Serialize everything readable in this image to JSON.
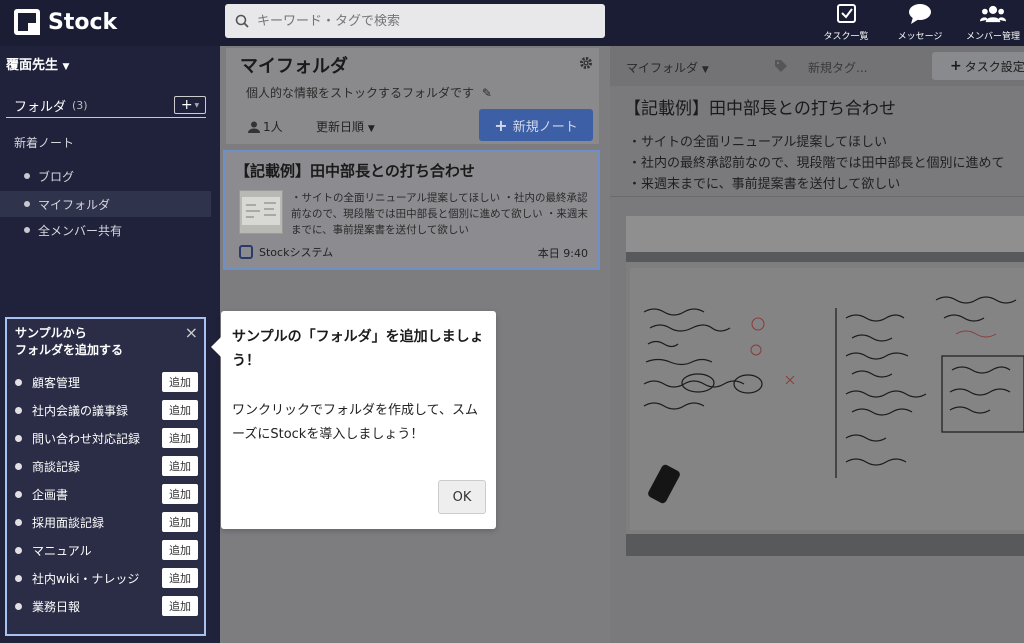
{
  "topbar": {
    "logo": "Stock",
    "search_placeholder": "キーワード・タグで検索",
    "nav": [
      {
        "label": "タスク一覧",
        "icon": "check-square-icon"
      },
      {
        "label": "メッセージ",
        "icon": "chat-bubble-icon"
      },
      {
        "label": "メンバー管理",
        "icon": "users-icon"
      }
    ]
  },
  "sidebar": {
    "user_name": "覆面先生",
    "folders_label": "フォルダ",
    "folders_count": "(3)",
    "add_button": "+",
    "new_notes": "新着ノート",
    "folders": [
      "ブログ",
      "マイフォルダ",
      "全メンバー共有"
    ]
  },
  "sample_panel": {
    "title_line1": "サンプルから",
    "title_line2": "フォルダを追加する",
    "close": "×",
    "add_label": "追加",
    "items": [
      "顧客管理",
      "社内会議の議事録",
      "問い合わせ対応記録",
      "商談記録",
      "企画書",
      "採用面談記録",
      "マニュアル",
      "社内wiki・ナレッジ",
      "業務日報"
    ]
  },
  "middle": {
    "folder_title": "マイフォルダ",
    "folder_desc": "個人的な情報をストックするフォルダです",
    "member_count": "1人",
    "sort_label": "更新日順",
    "new_note": "新規ノート",
    "note": {
      "title": "【記載例】田中部長との打ち合わせ",
      "excerpt": "・サイトの全面リニューアル提案してほしい ・社内の最終承認前なので、現段階では田中部長と個別に進めて欲しい ・来週末までに、事前提案書を送付して欲しい",
      "author": "Stockシステム",
      "time": "本日 9:40"
    }
  },
  "popover": {
    "title": "サンプルの「フォルダ」を追加しましょう！",
    "body": "ワンクリックでフォルダを作成して、スムーズにStockを導入しましょう！",
    "ok": "OK"
  },
  "right": {
    "folder_select": "マイフォルダ",
    "tag_placeholder": "新規タグ...",
    "task_button": "タスク設定",
    "doc_title": "【記載例】田中部長との打ち合わせ",
    "doc_lines": [
      "・サイトの全面リニューアル提案してほしい",
      "・社内の最終承認前なので、現段階では田中部長と個別に進めて",
      "・来週末までに、事前提案書を送付して欲しい"
    ]
  }
}
